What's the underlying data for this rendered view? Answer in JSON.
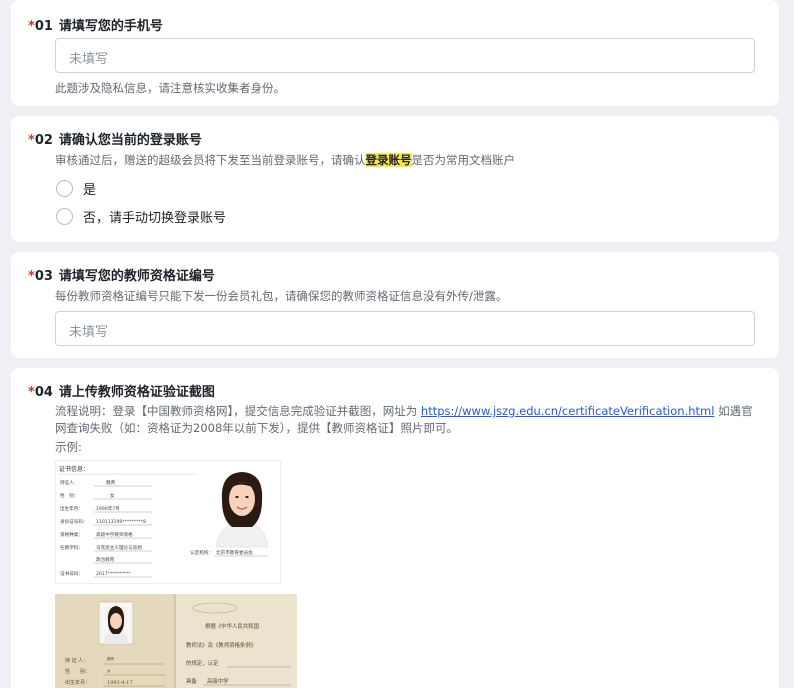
{
  "q1": {
    "required": "*",
    "num": "01",
    "title": "请填写您的手机号",
    "placeholder": "未填写",
    "hint": "此题涉及隐私信息，请注意核实收集者身份。"
  },
  "q2": {
    "required": "*",
    "num": "02",
    "title": "请确认您当前的登录账号",
    "hint_pre": "审核通过后，赠送的超级会员将下发至当前登录账号，请确认",
    "hint_hl": "登录账号",
    "hint_post": "是否为常用文档账户",
    "options": [
      "是",
      "否，请手动切换登录账号"
    ]
  },
  "q3": {
    "required": "*",
    "num": "03",
    "title": "请填写您的教师资格证编号",
    "hint": "每份教师资格证编号只能下发一份会员礼包，请确保您的教师资格证信息没有外传/泄露。",
    "placeholder": "未填写"
  },
  "q4": {
    "required": "*",
    "num": "04",
    "title": "请上传教师资格证验证截图",
    "desc_pre": "流程说明：登录【中国教师资格网】，提交信息完成验证并截图，网址为 ",
    "desc_link": "https://www.jszg.edu.cn/certificateVerification.html",
    "desc_post": " 如遇官网查询失败（如：资格证为2008年以前下发），提供【教师资格证】照片即可。",
    "example_label": "示例:",
    "cert": {
      "header": "证书信息：",
      "rows": [
        {
          "label": "持证人：",
          "value": "魏青"
        },
        {
          "label": "性　别：",
          "value": "女"
        },
        {
          "label": "出生年月：",
          "value": "1990年7月"
        },
        {
          "label": "身份证号码：",
          "value": "110113199*********8"
        },
        {
          "label": "资格种类：",
          "value": "高级中学教师资格"
        },
        {
          "label": "任教学科：",
          "value": "马克思主义理论与思想"
        },
        {
          "label": "",
          "value": "政治教育"
        },
        {
          "label": "证书号码：",
          "value": "2017**********"
        }
      ],
      "authority_label": "认定机构：",
      "authority_value": "北京市教育委员会"
    },
    "booklet": {
      "right_line1": "根据《中华人民共和国",
      "right_line2": "教师法》及《教师资格条例》",
      "right_line3": "的规定，认定",
      "right_line4": "具备",
      "right_fill": "高级中学",
      "left_rows": [
        {
          "label": "持 证 人：",
          "value": "魏青"
        },
        {
          "label": "性　　别：",
          "value": "女"
        },
        {
          "label": "出生年月：",
          "value": "1993-4-17"
        }
      ]
    }
  }
}
